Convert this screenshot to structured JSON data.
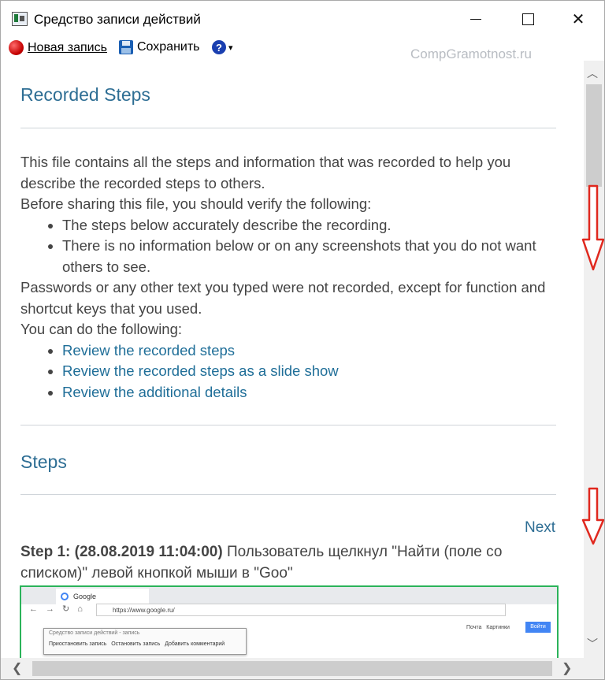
{
  "window": {
    "title": "Средство записи действий",
    "controls": [
      "minimize",
      "maximize",
      "close"
    ]
  },
  "toolbar": {
    "new_record_label": "Новая запись",
    "save_label": "Сохранить",
    "help_caret": "▾"
  },
  "watermark": "CompGramotnost.ru",
  "document": {
    "heading": "Recorded Steps",
    "intro": "This file contains all the steps and information that was recorded to help you describe the recorded steps to others.",
    "verify_intro": "Before sharing this file, you should verify the following:",
    "verify_items": [
      "The steps below accurately describe the recording.",
      "There is no information below or on any screenshots that you do not want others to see."
    ],
    "passwords_note": "Passwords or any other text you typed were not recorded, except for function and shortcut keys that you used.",
    "options_intro": "You can do the following:",
    "links": [
      "Review the recorded steps",
      "Review the recorded steps as a slide show",
      "Review the additional details"
    ],
    "steps_heading": "Steps",
    "next_label": "Next",
    "step1": {
      "label": "Step 1: (28.08.2019 11:04:00)",
      "text": " Пользователь щелкнул \"Найти (поле со списком)\" левой кнопкой мыши в \"Goo\""
    }
  },
  "screenshot": {
    "tab_title": "Google",
    "url": "https://www.google.ru/",
    "dialog_title": "Средство записи действий - запись",
    "dialog_buttons": [
      "Приостановить запись",
      "Остановить запись",
      "Добавить комментарий"
    ],
    "links": [
      "Почта",
      "Картинки"
    ],
    "login_button": "Войти"
  },
  "colors": {
    "heading": "#2e6e94",
    "link": "#1f6e98",
    "body_text": "#444444",
    "annotation_arrow": "#e0281e",
    "screenshot_border": "#2bb35a"
  }
}
